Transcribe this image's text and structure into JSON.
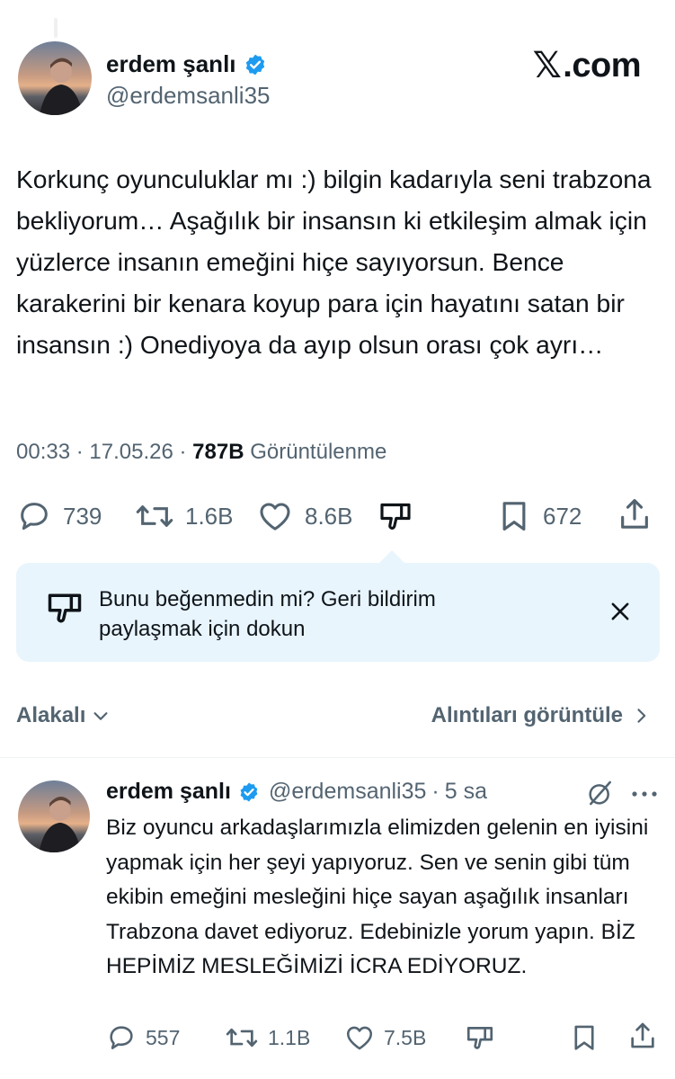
{
  "header": {
    "display_name": "erdem şanlı",
    "handle": "@erdemsanli35",
    "brand": "X.com",
    "brand_mark": "𝕏",
    "brand_suffix": ".com",
    "verified_color": "#1d9bf0"
  },
  "tweet": {
    "text": "Korkunç oyunculuklar mı :) bilgin kadarıyla seni trabzona bekliyorum… Aşağılık bir insansın ki etkileşim almak için yüzlerce insanın emeğini hiçe sayıyorsun. Bence karakerini bir kenara koyup para için hayatını satan bir insansın :) Onediyoya da ayıp olsun orası çok ayrı…",
    "time": "00:33",
    "date": "17.05.26",
    "views": "787B",
    "views_label": "Görüntülenme",
    "stats": {
      "replies": "739",
      "reposts": "1.6B",
      "likes": "8.6B",
      "bookmarks": "672"
    }
  },
  "feedback": {
    "line1": "Bunu beğenmedin mi? Geri bildirim",
    "line2": "paylaşmak için dokun",
    "background": "#e8f5fd"
  },
  "sort": {
    "label": "Alakalı",
    "quotes_link": "Alıntıları görüntüle"
  },
  "reply": {
    "display_name": "erdem şanlı",
    "handle": "@erdemsanli35",
    "separator": "·",
    "time": "5 sa",
    "text": "Biz oyuncu arkadaşlarımızla elimizden gelenin en iyisini yapmak için her şeyi yapıyoruz. Sen ve senin gibi tüm ekibin emeğini mesleğini hiçe sayan aşağılık insanları Trabzona davet ediyoruz. Edebinizle yorum yapın. BİZ HEPİMİZ MESLEĞİMİZİ İCRA EDİYORUZ.",
    "stats": {
      "replies": "557",
      "reposts": "1.1B",
      "likes": "7.5B"
    }
  },
  "icons": [
    "reply-icon",
    "repost-icon",
    "like-icon",
    "dislike-icon",
    "bookmark-icon",
    "share-icon",
    "close-icon",
    "chevron-down-icon",
    "chevron-right-icon",
    "grok-icon",
    "more-icon",
    "verified-badge-icon"
  ]
}
